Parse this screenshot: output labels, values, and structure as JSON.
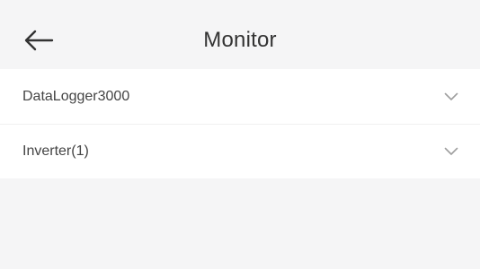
{
  "header": {
    "title": "Monitor",
    "back_icon": "arrow-left-icon"
  },
  "devices": [
    {
      "label": "DataLogger3000",
      "icon": "chevron-down-icon"
    },
    {
      "label": "Inverter(1)",
      "icon": "chevron-down-icon"
    }
  ],
  "colors": {
    "background": "#f5f5f6",
    "list_background": "#ffffff",
    "text": "#333333",
    "chevron": "#9e9e9e"
  }
}
